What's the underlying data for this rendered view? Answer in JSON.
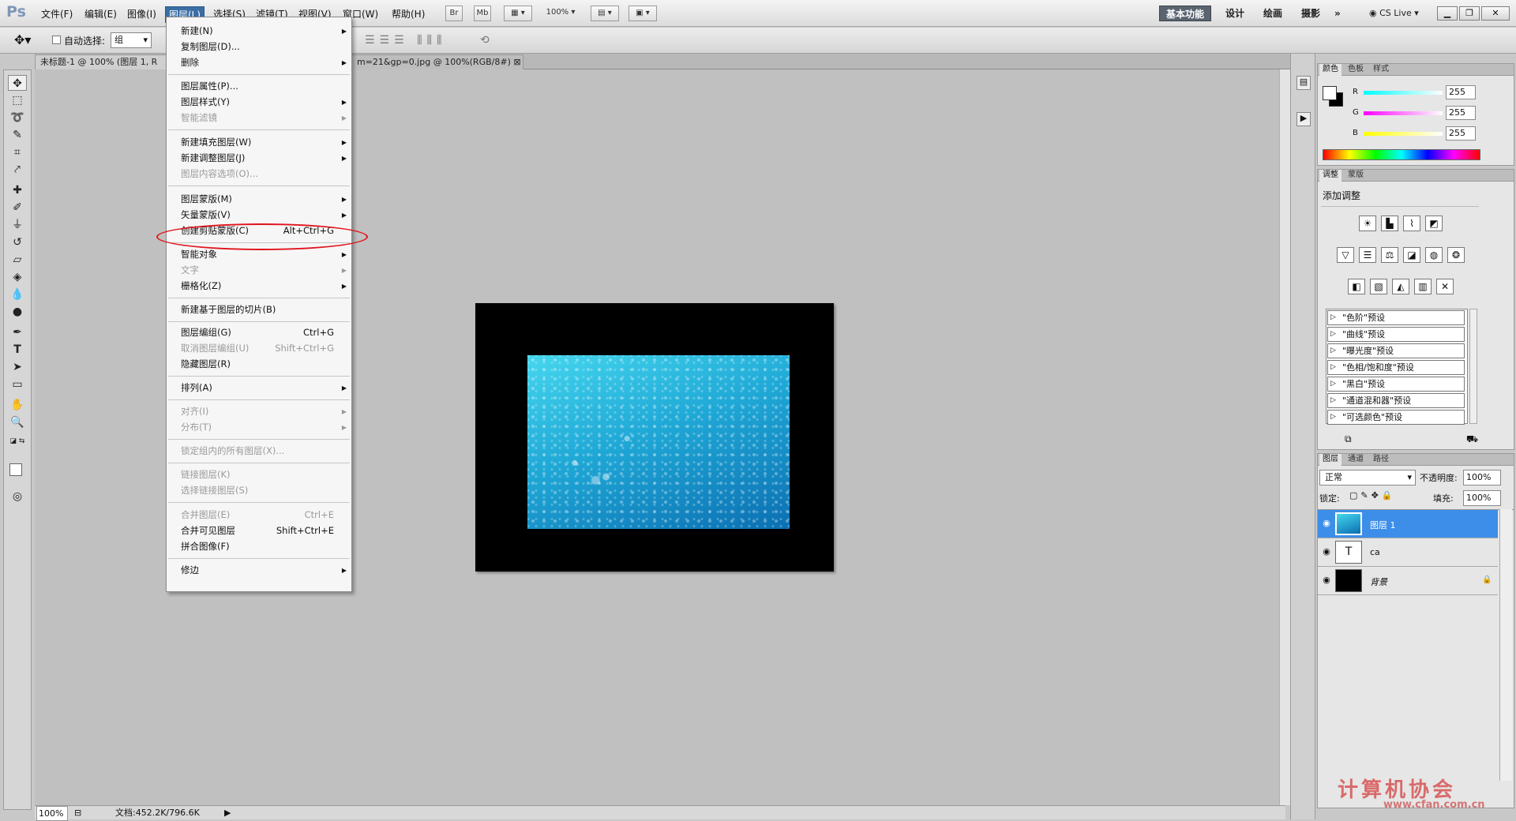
{
  "app": {
    "logo": "Ps"
  },
  "menubar": {
    "items": [
      {
        "label": "文件(F)"
      },
      {
        "label": "编辑(E)"
      },
      {
        "label": "图像(I)"
      },
      {
        "label": "图层(L)"
      },
      {
        "label": "选择(S)"
      },
      {
        "label": "滤镜(T)"
      },
      {
        "label": "视图(V)"
      },
      {
        "label": "窗口(W)"
      },
      {
        "label": "帮助(H)"
      }
    ],
    "bridge_label": "Br",
    "minibridge_label": "Mb",
    "zoom_value": "100%",
    "workspaces": [
      "基本功能",
      "设计",
      "绘画",
      "摄影"
    ],
    "more_label": "»",
    "cslive_label": "CS Live"
  },
  "options": {
    "auto_select_label": "自动选择:",
    "auto_select_value": "组"
  },
  "tabs": [
    {
      "label": "未标题-1 @ 100% (图层 1, R"
    },
    {
      "label": "m=21&gp=0.jpg @ 100%(RGB/8#)"
    }
  ],
  "layer_menu": {
    "groups": [
      [
        {
          "label": "新建(N)",
          "sub": true
        },
        {
          "label": "复制图层(D)..."
        },
        {
          "label": "删除",
          "sub": true
        }
      ],
      [
        {
          "label": "图层属性(P)..."
        },
        {
          "label": "图层样式(Y)",
          "sub": true
        },
        {
          "label": "智能滤镜",
          "sub": true,
          "disabled": true
        }
      ],
      [
        {
          "label": "新建填充图层(W)",
          "sub": true
        },
        {
          "label": "新建调整图层(J)",
          "sub": true
        },
        {
          "label": "图层内容选项(O)...",
          "disabled": true
        }
      ],
      [
        {
          "label": "图层蒙版(M)",
          "sub": true
        },
        {
          "label": "矢量蒙版(V)",
          "sub": true
        },
        {
          "label": "创建剪贴蒙版(C)",
          "shortcut": "Alt+Ctrl+G"
        }
      ],
      [
        {
          "label": "智能对象",
          "sub": true
        },
        {
          "label": "文字",
          "sub": true,
          "disabled": true
        },
        {
          "label": "栅格化(Z)",
          "sub": true
        }
      ],
      [
        {
          "label": "新建基于图层的切片(B)"
        }
      ],
      [
        {
          "label": "图层编组(G)",
          "shortcut": "Ctrl+G"
        },
        {
          "label": "取消图层编组(U)",
          "shortcut": "Shift+Ctrl+G",
          "disabled": true
        },
        {
          "label": "隐藏图层(R)"
        }
      ],
      [
        {
          "label": "排列(A)",
          "sub": true
        }
      ],
      [
        {
          "label": "对齐(I)",
          "sub": true,
          "disabled": true
        },
        {
          "label": "分布(T)",
          "sub": true,
          "disabled": true
        }
      ],
      [
        {
          "label": "锁定组内的所有图层(X)...",
          "disabled": true
        }
      ],
      [
        {
          "label": "链接图层(K)",
          "disabled": true
        },
        {
          "label": "选择链接图层(S)",
          "disabled": true
        }
      ],
      [
        {
          "label": "合并图层(E)",
          "shortcut": "Ctrl+E",
          "disabled": true
        },
        {
          "label": "合并可见图层",
          "shortcut": "Shift+Ctrl+E"
        },
        {
          "label": "拼合图像(F)"
        }
      ],
      [
        {
          "label": "修边",
          "sub": true
        }
      ]
    ]
  },
  "color_panel": {
    "tabs": [
      "颜色",
      "色板",
      "样式"
    ],
    "channels": [
      {
        "name": "R",
        "value": "255"
      },
      {
        "name": "G",
        "value": "255"
      },
      {
        "name": "B",
        "value": "255"
      }
    ]
  },
  "adjust_panel": {
    "tabs": [
      "调整",
      "蒙版"
    ],
    "title": "添加调整",
    "presets": [
      "\"色阶\"预设",
      "\"曲线\"预设",
      "\"曝光度\"预设",
      "\"色相/饱和度\"预设",
      "\"黑白\"预设",
      "\"通道混和器\"预设",
      "\"可选颜色\"预设"
    ]
  },
  "layers_panel": {
    "tabs": [
      "图层",
      "通道",
      "路径"
    ],
    "blend_mode": "正常",
    "opacity_label": "不透明度:",
    "opacity_value": "100%",
    "lock_label": "锁定:",
    "fill_label": "填充:",
    "fill_value": "100%",
    "layers": [
      {
        "name": "图层 1",
        "selected": true
      },
      {
        "name": "ca",
        "thumb": "T"
      },
      {
        "name": "背景"
      }
    ]
  },
  "status": {
    "zoom": "100%",
    "doc_info": "文档:452.2K/796.6K"
  },
  "watermark": {
    "text": "计算机协会",
    "url": "www.cfan.com.cn"
  },
  "colors": {
    "menu_active": "#3a6ea5",
    "layer_selected": "#3d8ee8",
    "highlight_oval": "#e0141c"
  }
}
